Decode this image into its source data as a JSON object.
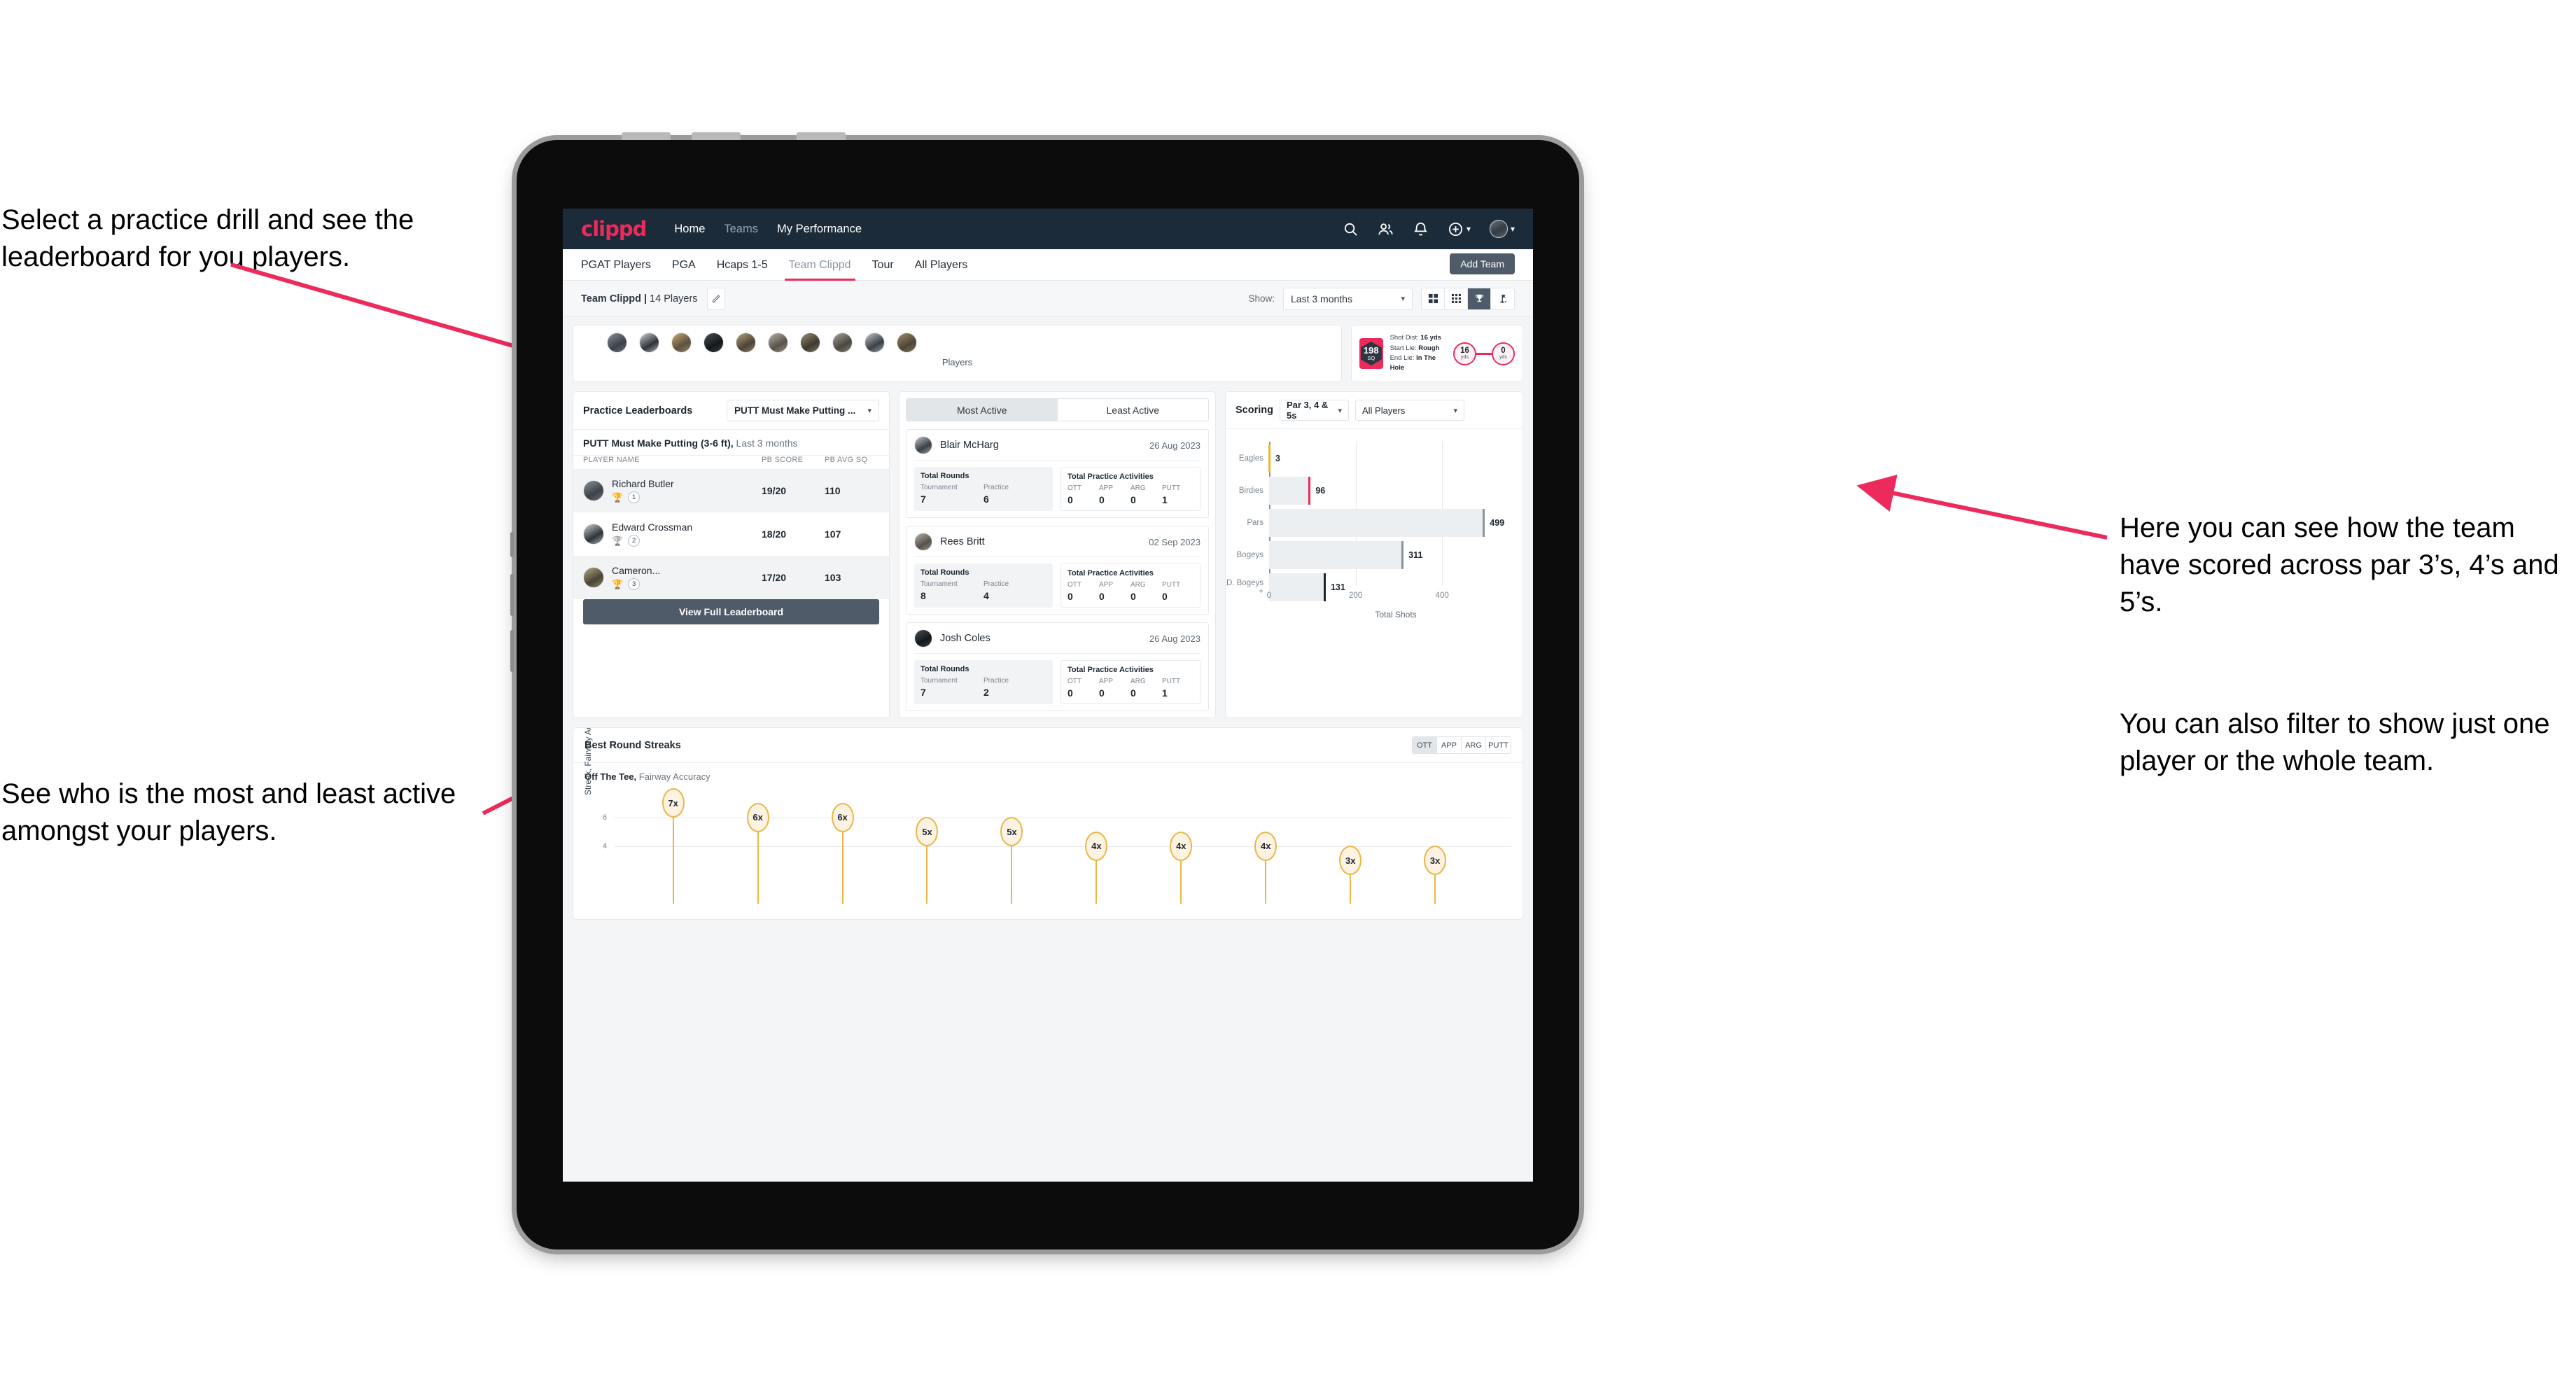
{
  "annotations": {
    "top_left": "Select a practice drill and see the leaderboard for you players.",
    "bottom_left": "See who is the most and least active amongst your players.",
    "right_1": "Here you can see how the team have scored across par 3’s, 4’s and 5’s.",
    "right_2": "You can also filter to show just one player or the whole team."
  },
  "topnav": {
    "logo": "clippd",
    "links": [
      {
        "label": "Home",
        "dim": false
      },
      {
        "label": "Teams",
        "dim": true
      },
      {
        "label": "My Performance",
        "dim": false
      }
    ],
    "icons": [
      "search-icon",
      "people-icon",
      "bell-icon",
      "plus-circle-icon"
    ]
  },
  "tabs": {
    "items": [
      {
        "label": "PGAT Players",
        "active": false,
        "dim": false
      },
      {
        "label": "PGA",
        "active": false,
        "dim": false
      },
      {
        "label": "Hcaps 1-5",
        "active": false,
        "dim": false
      },
      {
        "label": "Team Clippd",
        "active": true,
        "dim": true
      },
      {
        "label": "Tour",
        "active": false,
        "dim": false
      },
      {
        "label": "All Players",
        "active": false,
        "dim": false
      }
    ],
    "add_team_label": "Add Team"
  },
  "filterbar": {
    "team_name": "Team Clippd | ",
    "team_count": "14 Players",
    "show_label": "Show:",
    "show_value": "Last 3 months",
    "view_toggles": [
      "grid-large-icon",
      "grid-small-icon",
      "trophy-icon",
      "flag-icon"
    ],
    "active_toggle": 2
  },
  "players_strip": {
    "caption": "Players",
    "avatar_count": 10
  },
  "shot_card": {
    "sq_value": "198",
    "sq_unit": "SQ",
    "lines": [
      {
        "label": "Shot Dist: ",
        "value": "16 yds"
      },
      {
        "label": "Start Lie: ",
        "value": "Rough"
      },
      {
        "label": "End Lie: ",
        "value": "In The Hole"
      }
    ],
    "start_dist": "16",
    "start_unit": "yds",
    "end_dist": "0",
    "end_unit": "yds"
  },
  "leaderboard": {
    "title": "Practice Leaderboards",
    "drill_select": "PUTT Must Make Putting ...",
    "subtitle_bold": "PUTT Must Make Putting (3-6 ft),",
    "subtitle_rest": " Last 3 months",
    "columns": [
      "PLAYER NAME",
      "PB SCORE",
      "PB AVG SQ"
    ],
    "rows": [
      {
        "name": "Richard Butler",
        "trophy": "🏆",
        "rank": "1",
        "score": "19/20",
        "avg_sq": "110"
      },
      {
        "name": "Edward Crossman",
        "trophy": "🏆",
        "rank": "2",
        "score": "18/20",
        "avg_sq": "107"
      },
      {
        "name": "Cameron...",
        "trophy": "🏆",
        "rank": "3",
        "score": "17/20",
        "avg_sq": "103"
      }
    ],
    "button_label": "View Full Leaderboard"
  },
  "activity": {
    "tabs": [
      {
        "label": "Most Active",
        "active": true
      },
      {
        "label": "Least Active",
        "active": false
      }
    ],
    "rounds_title": "Total Rounds",
    "rounds_cols": [
      "Tournament",
      "Practice"
    ],
    "practice_title": "Total Practice Activities",
    "practice_cols": [
      "OTT",
      "APP",
      "ARG",
      "PUTT"
    ],
    "items": [
      {
        "name": "Blair McHarg",
        "date": "26 Aug 2023",
        "tournament": "7",
        "practice": "6",
        "ott": "0",
        "app": "0",
        "arg": "0",
        "putt": "1"
      },
      {
        "name": "Rees Britt",
        "date": "02 Sep 2023",
        "tournament": "8",
        "practice": "4",
        "ott": "0",
        "app": "0",
        "arg": "0",
        "putt": "0"
      },
      {
        "name": "Josh Coles",
        "date": "26 Aug 2023",
        "tournament": "7",
        "practice": "2",
        "ott": "0",
        "app": "0",
        "arg": "0",
        "putt": "1"
      }
    ]
  },
  "scoring": {
    "title": "Scoring",
    "par_select": "Par 3, 4 & 5s",
    "player_select": "All Players"
  },
  "streaks": {
    "title": "Best Round Streaks",
    "toggles": [
      {
        "label": "OTT",
        "active": true
      },
      {
        "label": "APP",
        "active": false
      },
      {
        "label": "ARG",
        "active": false
      },
      {
        "label": "PUTT",
        "active": false
      }
    ],
    "sub_bold": "Off The Tee,",
    "sub_rest": " Fairway Accuracy"
  },
  "chart_data": [
    {
      "type": "bar",
      "title": "Scoring",
      "orientation": "horizontal",
      "categories": [
        "Eagles",
        "Birdies",
        "Pars",
        "Bogeys",
        "D. Bogeys +"
      ],
      "values": [
        3,
        96,
        499,
        311,
        131
      ],
      "cap_colors": [
        "#f0b429",
        "#ec2a5b",
        "#8a949d",
        "#8a949d",
        "#1d262f"
      ],
      "xlabel": "Total Shots",
      "ylabel": "",
      "xlim": [
        0,
        560
      ],
      "xticks": [
        0,
        200,
        400
      ],
      "grid": true,
      "legend": false
    },
    {
      "type": "bar",
      "title": "Off The Tee, Fairway Accuracy",
      "subtype": "lollipop",
      "categories": [
        "",
        "",
        "",
        "",
        "",
        "",
        "",
        "",
        "",
        "",
        ""
      ],
      "values": [
        7,
        6,
        6,
        5,
        5,
        4,
        4,
        4,
        3,
        3
      ],
      "labels": [
        "7x",
        "6x",
        "6x",
        "5x",
        "5x",
        "4x",
        "4x",
        "4x",
        "3x",
        "3x"
      ],
      "ylabel": "Streak, Fairway Accuracy",
      "ylim": [
        0,
        7.8
      ],
      "yticks": [
        4,
        6
      ],
      "grid": true,
      "accent": "#eab646"
    }
  ]
}
